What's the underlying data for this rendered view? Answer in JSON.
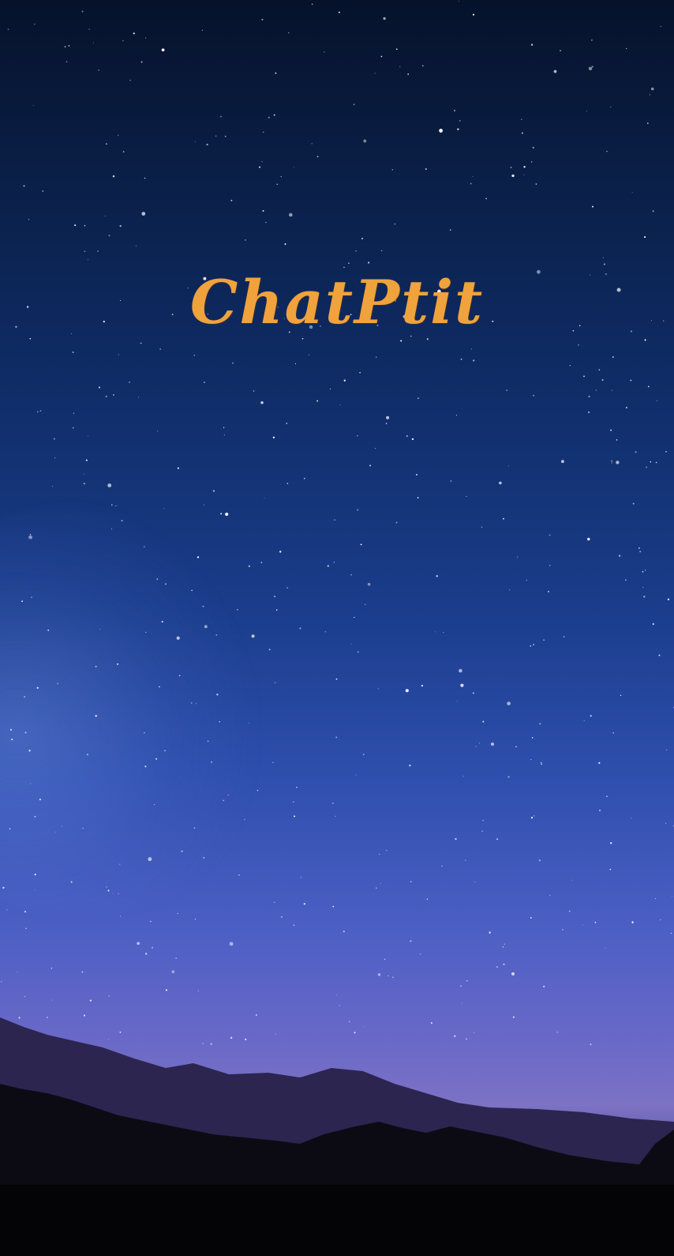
{
  "app": {
    "title": "ChatPtit"
  },
  "colors": {
    "logo_text": "#f0a23d",
    "sky_top": "#06122a",
    "sky_bottom": "#7d72c4",
    "ground": "#050509"
  },
  "background": {
    "scene": "starry-night-sky-over-mountains"
  }
}
